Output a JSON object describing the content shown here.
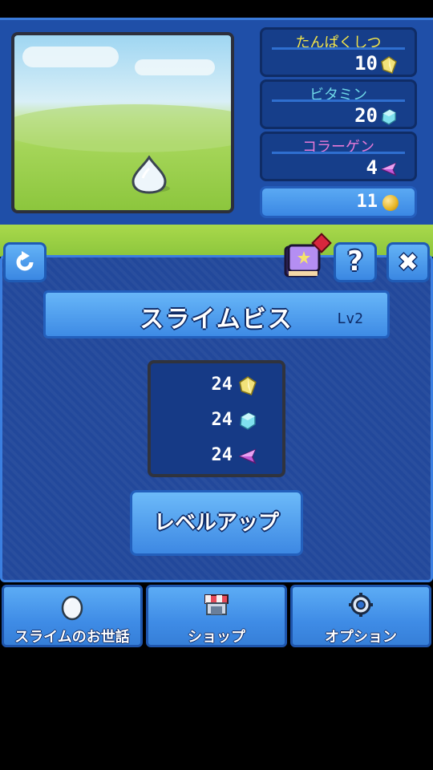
{
  "stats": [
    {
      "label": "たんぱくしつ",
      "value": "10",
      "color": "#f2e44a",
      "icon": "yellow-crystal-icon"
    },
    {
      "label": "ビタミン",
      "value": "20",
      "color": "#6fd8e8",
      "icon": "cyan-cube-icon"
    },
    {
      "label": "コラーゲン",
      "value": "4",
      "color": "#e87ad8",
      "icon": "purple-gem-icon"
    }
  ],
  "coins": {
    "value": "11",
    "icon": "coin-icon"
  },
  "toolbar": {
    "refresh_icon": "refresh-icon",
    "book_icon": "book-icon",
    "help_label": "?",
    "close_label": "✖"
  },
  "slime": {
    "name": "スライムビス",
    "level": "Lv2"
  },
  "cost": [
    {
      "value": "24",
      "icon": "yellow-crystal-icon"
    },
    {
      "value": "24",
      "icon": "cyan-cube-icon"
    },
    {
      "value": "24",
      "icon": "purple-gem-icon"
    }
  ],
  "levelup_label": "レベルアップ",
  "nav": [
    {
      "label": "スライムのお世話",
      "icon": "egg-icon"
    },
    {
      "label": "ショップ",
      "icon": "shop-icon"
    },
    {
      "label": "オプション",
      "icon": "gear-icon"
    }
  ]
}
